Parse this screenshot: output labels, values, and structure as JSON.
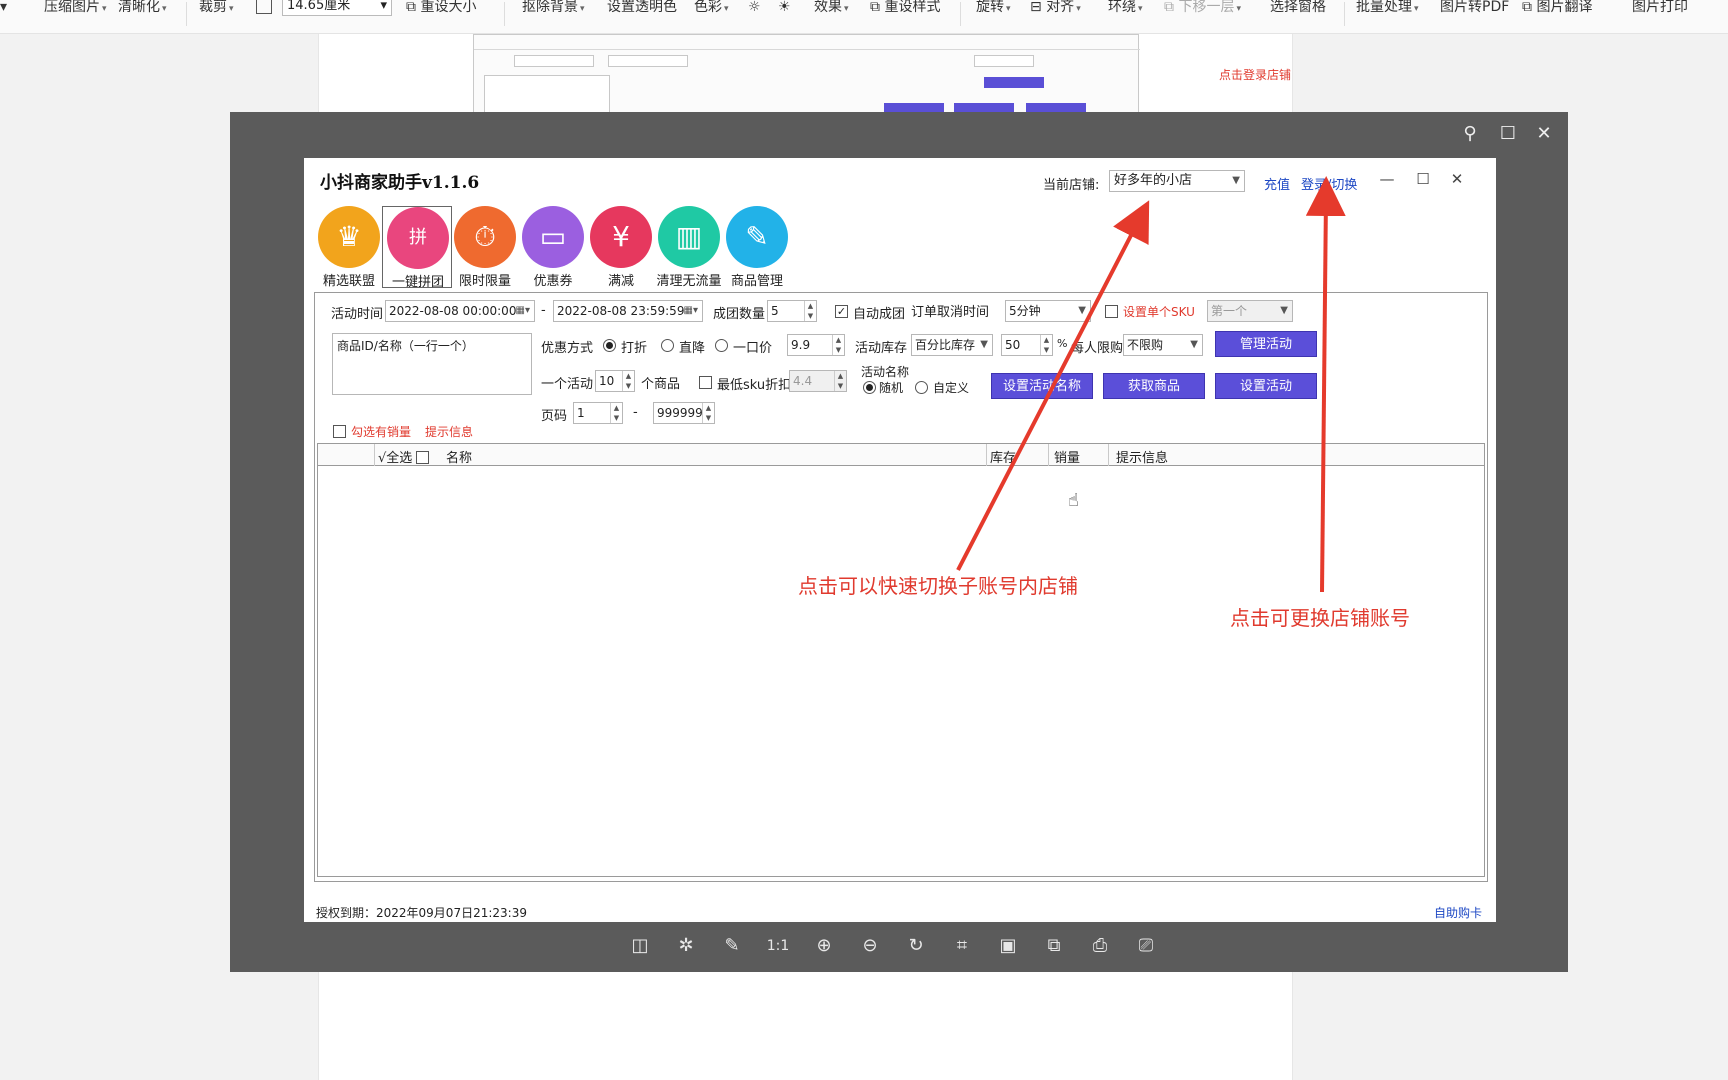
{
  "ribbon": {
    "items": [
      {
        "label": "压缩图片",
        "caret": "▾"
      },
      {
        "label": "清晰化",
        "caret": "▾"
      },
      {
        "label": "裁剪",
        "caret": "▾"
      },
      {
        "label": "14.65厘米",
        "caret": "▾"
      },
      {
        "label": "重设大小",
        "caret": ""
      },
      {
        "label": "抠除背景",
        "caret": "▾"
      },
      {
        "label": "设置透明色",
        "caret": ""
      },
      {
        "label": "色彩",
        "caret": "▾"
      },
      {
        "label": "效果",
        "caret": "▾"
      },
      {
        "label": "重设样式",
        "caret": ""
      },
      {
        "label": "旋转",
        "caret": "▾"
      },
      {
        "label": "对齐",
        "caret": "▾"
      },
      {
        "label": "环绕",
        "caret": "▾"
      },
      {
        "label": "下移一层",
        "caret": "▾"
      },
      {
        "label": "选择窗格",
        "caret": ""
      },
      {
        "label": "批量处理",
        "caret": "▾"
      },
      {
        "label": "图片转PDF",
        "caret": ""
      },
      {
        "label": "图片翻译",
        "caret": ""
      },
      {
        "label": "图片打印",
        "caret": ""
      }
    ]
  },
  "doc_thumb": {
    "red_text": "点击登录店铺"
  },
  "viewer": {
    "controls": [
      "pin-icon",
      "maximize-icon",
      "close-icon"
    ],
    "bottom_tools": [
      "split-view-icon",
      "magic-icon",
      "edit-image-icon",
      "actual-size-icon",
      "zoom-in-icon",
      "zoom-out-icon",
      "rotate-icon",
      "crop-icon",
      "image-icon",
      "compare-icon",
      "save-icon",
      "print-icon"
    ],
    "actual_size_label": "1:1"
  },
  "app": {
    "title": "小抖商家助手v1.1.6",
    "shop_label": "当前店铺:",
    "shop_value": "好多年的小店",
    "recharge": "充值",
    "login_switch": "登录/切换",
    "modules": [
      {
        "label": "精选联盟",
        "icon": "crown-icon",
        "glyph": "♛",
        "color": "#f2a41c"
      },
      {
        "label": "一键拼团",
        "icon": "shopping-bag-icon",
        "glyph": "拼",
        "color": "#e9467e"
      },
      {
        "label": "限时限量",
        "icon": "stopwatch-icon",
        "glyph": "⏱",
        "color": "#ef6a2f"
      },
      {
        "label": "优惠券",
        "icon": "ticket-icon",
        "glyph": "▭",
        "color": "#9b5fe0"
      },
      {
        "label": "满减",
        "icon": "red-envelope-icon",
        "glyph": "¥",
        "color": "#e6385e"
      },
      {
        "label": "清理无流量",
        "icon": "broom-icon",
        "glyph": "▥",
        "color": "#1fc9a4"
      },
      {
        "label": "商品管理",
        "icon": "edit-note-icon",
        "glyph": "✎",
        "color": "#22b2e8"
      }
    ],
    "form": {
      "activity_time_label": "活动时间",
      "start_time": "2022-08-08 00:00:00",
      "dash": "-",
      "end_time": "2022-08-08 23:59:59",
      "group_count_label": "成团数量",
      "group_count": "5",
      "auto_group_label": "自动成团",
      "auto_group_checked": true,
      "cancel_time_label": "订单取消时间",
      "cancel_time_value": "5分钟",
      "single_sku_label": "设置单个SKU",
      "sku_select": "第一个",
      "id_placeholder": "商品ID/名称（一行一个）",
      "discount_label": "优惠方式",
      "discount_options": [
        "打折",
        "直降",
        "一口价"
      ],
      "discount_value": "9.9",
      "stock_label": "活动库存",
      "stock_select": "百分比库存",
      "stock_value": "50",
      "percent": "%",
      "limit_label": "每人限购",
      "limit_select": "不限购",
      "per_activity_label": "一个活动",
      "per_activity_value": "10",
      "items_label": "个商品",
      "min_sku_label": "最低sku折扣",
      "min_sku_value": "4.4",
      "activity_name_label": "活动名称",
      "name_options": [
        "随机",
        "自定义"
      ],
      "page_label": "页码",
      "page_from": "1",
      "page_to": "999999",
      "has_sales_label": "勾选有销量",
      "tip_label": "提示信息",
      "btn_manage": "管理活动",
      "btn_set_name": "设置活动名称",
      "btn_fetch": "获取商品",
      "btn_set": "设置活动"
    },
    "table": {
      "headers": [
        "√全选",
        "名称",
        "库存",
        "销量",
        "提示信息"
      ]
    },
    "status": "授权到期：2022年09月07日21:23:39",
    "self_card": "自助购卡"
  },
  "annotations": {
    "left": "点击可以快速切换子账号内店铺",
    "right": "点击可更换店铺账号"
  }
}
